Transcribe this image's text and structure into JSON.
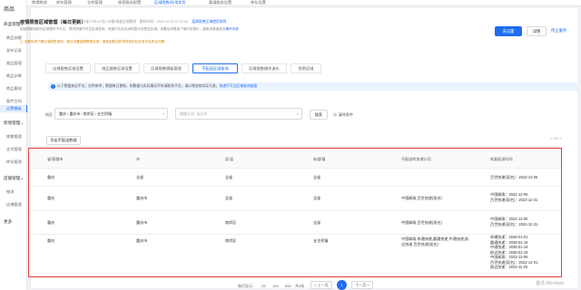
{
  "sidebar": {
    "title": "商品",
    "groups": [
      {
        "label": "商品管理",
        "items": [
          "商品创建",
          "发布记录",
          "商品管理",
          "商品诊断",
          "商品素材",
          "图片空间",
          "运费模板"
        ]
      },
      {
        "label": "跨境管理",
        "items": [
          "销售管理",
          "支付管理",
          "库存管理"
        ]
      },
      {
        "label": "店铺管理",
        "items": [
          "物流",
          "店铺管理"
        ]
      },
      {
        "label": "更多",
        "items": []
      }
    ],
    "active_item": "运费模板"
  },
  "top_tabs": [
    "跨境物流",
    "库存管理",
    "仓库管理",
    "商家服务配置",
    "区域限售/异常发货",
    "渠道服务设置",
    "库存设置"
  ],
  "top_tab_active_index": 4,
  "header": {
    "title": "疫情限售区域管理（每日更新）",
    "subinfo": "22省72市147区718镇/街道全部解除 · 更新时间：2022.12.02 07:12:03",
    "subinfo_link": "疫情限售区域使用说明",
    "desc": "因疫情原因部分区域暂时不可达，提供快递不可达区域查询，快递可达后自动恢复为可配送区域；设置后消费者下单时将提示，避免消费者投诉",
    "desc_link": "操作手册",
    "warn": "设置前请了解区域限售规则，建议设置疫情限售区域，避免因配送异常导致的延迟发货及售后问题",
    "btn_set": "去设置",
    "btn_detail": "详情",
    "link_trial": "停止服务"
  },
  "subtabs": [
    "店铺限售区域设置",
    "商品限售区域设置",
    "区域限售模板管理",
    "不配送区域查询",
    "区域限售操作流水",
    "免责区域"
  ],
  "subtab_active_index": 3,
  "notice": {
    "icon": "info-icon",
    "text": "以下数据来自平台，仅供参考，数据每日更新，如数据与实际情况不符请联系平台，请以物流商实际为准，",
    "link": "快递不可达区域查询链接"
  },
  "filters": {
    "region_label": "地区",
    "region_value": "重庆 / 重庆市 / 南岸区 / 长生桥镇",
    "company_label": "快递公司",
    "company_placeholder": "请选择",
    "search_btn": "搜索",
    "clear_link": "清除条件"
  },
  "toolbar": {
    "export_btn": "导出不配送数据",
    "page_mini": "< 1/1 >"
  },
  "table": {
    "headers": [
      "省/直辖市",
      "市",
      "区/县",
      "街道/镇",
      "不配送的快递公司",
      "恢复配送时间"
    ],
    "rows": [
      {
        "province": "重庆",
        "city": "全部",
        "district": "全部",
        "street": "全部",
        "companies": [],
        "times": [
          "百世快递(现名)：2022-12-06"
        ]
      },
      {
        "province": "重庆",
        "city": "重庆市",
        "district": "全部",
        "street": "全部",
        "companies": [
          "中国邮政,百世快递(现名)"
        ],
        "times": [
          "中国邮政：2022-12-06",
          "百世快递(现名)：2022-12-31"
        ]
      },
      {
        "province": "重庆",
        "city": "重庆市",
        "district": "南岸区",
        "street": "全部",
        "companies": [
          "中国邮政,百世快递(现名)"
        ],
        "times": [
          "中国邮政：2022-12-06",
          "百世快递(现名)：2022-12-31"
        ]
      },
      {
        "province": "重庆",
        "city": "重庆市",
        "district": "南岸区",
        "street": "长生桥镇",
        "companies": [
          "中国邮政,申通快递,圆通快递,中通快递,韵",
          "达快递,百世快递(现名)"
        ],
        "times": [
          "申通快递：2049-01-01",
          "圆通快递：2038-01-19",
          "中通快递：2038-01-19",
          "韵达快递：2038-01-19",
          "中国邮政：2022-12-06",
          "百世快递(现名)：2022-12-31",
          "韵达快递：2023-11-25"
        ]
      }
    ]
  },
  "pagination": {
    "per_page_label": "每页显示：",
    "sizes": [
      "25",
      "100",
      "500"
    ],
    "total": "共4条",
    "prev": "< 上一页",
    "current": "1",
    "next": "下一页 >"
  },
  "watermark": "激活 Windows",
  "colors": {
    "accent": "#1f6df0",
    "highlight_border": "#e23b3b",
    "warn": "#d48806"
  }
}
